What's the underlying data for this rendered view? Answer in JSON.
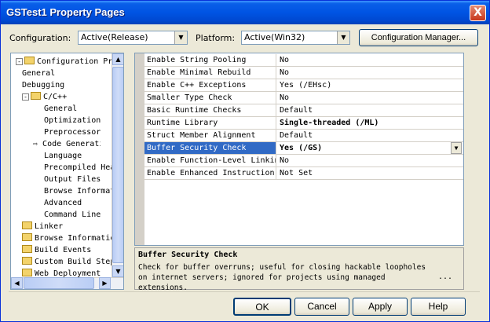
{
  "window": {
    "title": "GSTest1 Property Pages",
    "close_glyph": "X"
  },
  "toolbar": {
    "configuration_label": "Configuration:",
    "configuration_value": "Active(Release)",
    "platform_label": "Platform:",
    "platform_value": "Active(Win32)",
    "config_manager_label": "Configuration Manager..."
  },
  "tree": {
    "items": [
      {
        "label": "Configuration Properties",
        "level": 0,
        "folder": true,
        "expanded": true
      },
      {
        "label": "General",
        "level": 1,
        "folder": false
      },
      {
        "label": "Debugging",
        "level": 1,
        "folder": false
      },
      {
        "label": "C/C++",
        "level": 1,
        "folder": true,
        "expanded": true
      },
      {
        "label": "General",
        "level": 2,
        "folder": false
      },
      {
        "label": "Optimization",
        "level": 2,
        "folder": false
      },
      {
        "label": "Preprocessor",
        "level": 2,
        "folder": false
      },
      {
        "label": "Code Generation",
        "level": 2,
        "folder": false,
        "current": true
      },
      {
        "label": "Language",
        "level": 2,
        "folder": false
      },
      {
        "label": "Precompiled Headers",
        "level": 2,
        "folder": false
      },
      {
        "label": "Output Files",
        "level": 2,
        "folder": false
      },
      {
        "label": "Browse Information",
        "level": 2,
        "folder": false
      },
      {
        "label": "Advanced",
        "level": 2,
        "folder": false
      },
      {
        "label": "Command Line",
        "level": 2,
        "folder": false
      },
      {
        "label": "Linker",
        "level": 1,
        "folder": true
      },
      {
        "label": "Browse Information",
        "level": 1,
        "folder": true
      },
      {
        "label": "Build Events",
        "level": 1,
        "folder": true
      },
      {
        "label": "Custom Build Step",
        "level": 1,
        "folder": true
      },
      {
        "label": "Web Deployment",
        "level": 1,
        "folder": true
      }
    ]
  },
  "properties": {
    "rows": [
      {
        "name": "Enable String Pooling",
        "value": "No"
      },
      {
        "name": "Enable Minimal Rebuild",
        "value": "No"
      },
      {
        "name": "Enable C++ Exceptions",
        "value": "Yes (/EHsc)"
      },
      {
        "name": "Smaller Type Check",
        "value": "No"
      },
      {
        "name": "Basic Runtime Checks",
        "value": "Default"
      },
      {
        "name": "Runtime Library",
        "value": "Single-threaded (/ML)",
        "bold": true
      },
      {
        "name": "Struct Member Alignment",
        "value": "Default"
      },
      {
        "name": "Buffer Security Check",
        "value": "Yes (/GS)",
        "bold": true,
        "selected": true
      },
      {
        "name": "Enable Function-Level Linking",
        "value": "No"
      },
      {
        "name": "Enable Enhanced Instruction Set",
        "value": "Not Set"
      }
    ]
  },
  "description": {
    "title": "Buffer Security Check",
    "body": "Check for buffer overruns; useful for closing hackable loopholes on internet servers; ignored for projects using managed extensions.",
    "more": "..."
  },
  "buttons": {
    "ok": "OK",
    "cancel": "Cancel",
    "apply": "Apply",
    "help": "Help"
  },
  "icons": {
    "tree_expanded": "minus-box",
    "current_page": "arrow-right-icon",
    "dropdown": "chevron-down-icon"
  },
  "colors": {
    "title_bar": "#0054e3",
    "selection": "#316ac5",
    "window_bg": "#ece9d8"
  }
}
